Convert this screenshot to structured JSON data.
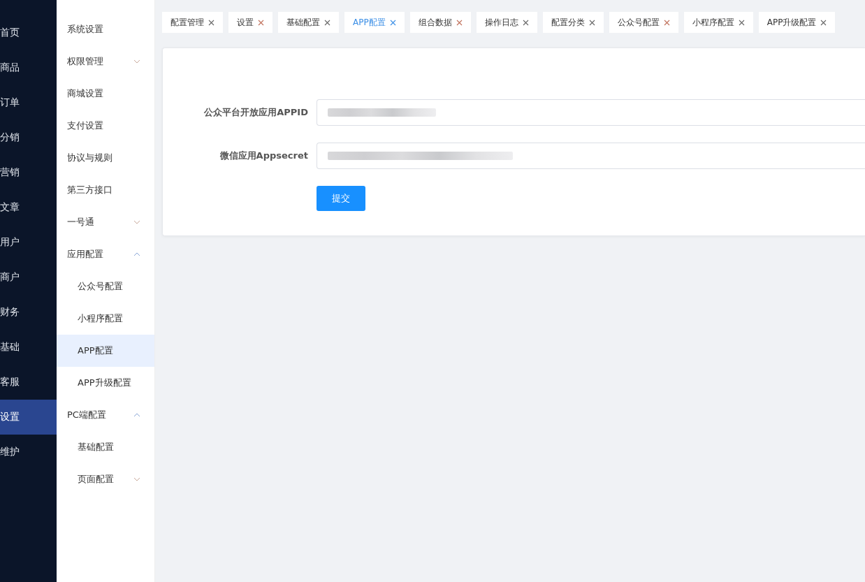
{
  "main_menu": [
    {
      "label": "首页",
      "selected": false
    },
    {
      "label": "商品",
      "selected": false
    },
    {
      "label": "订单",
      "selected": false
    },
    {
      "label": "分销",
      "selected": false
    },
    {
      "label": "营销",
      "selected": false
    },
    {
      "label": "文章",
      "selected": false
    },
    {
      "label": "用户",
      "selected": false
    },
    {
      "label": "商户",
      "selected": false
    },
    {
      "label": "财务",
      "selected": false
    },
    {
      "label": "基础",
      "selected": false
    },
    {
      "label": "客服",
      "selected": false
    },
    {
      "label": "设置",
      "selected": true
    },
    {
      "label": "维护",
      "selected": false
    }
  ],
  "sub_menu": [
    {
      "label": "系统设置",
      "selected": false
    },
    {
      "label": "权限管理",
      "selected": false,
      "expanded": false
    },
    {
      "label": "商城设置",
      "selected": false
    },
    {
      "label": "支付设置",
      "selected": false
    },
    {
      "label": "协议与规则",
      "selected": false
    },
    {
      "label": "第三方接口",
      "selected": false
    },
    {
      "label": "一号通",
      "selected": false,
      "expanded": false
    },
    {
      "label": "应用配置",
      "selected": false,
      "expanded": true,
      "children": [
        {
          "label": "公众号配置",
          "selected": false
        },
        {
          "label": "小程序配置",
          "selected": false
        },
        {
          "label": "APP配置",
          "selected": true
        },
        {
          "label": "APP升级配置",
          "selected": false
        }
      ]
    },
    {
      "label": "PC端配置",
      "selected": false,
      "expanded": true,
      "children": [
        {
          "label": "基础配置",
          "selected": false
        },
        {
          "label": "页面配置",
          "selected": false,
          "expanded": false
        }
      ]
    }
  ],
  "tabs": [
    {
      "label": "配置管理",
      "selected": false
    },
    {
      "label": "设置",
      "selected": false
    },
    {
      "label": "基础配置",
      "selected": false
    },
    {
      "label": "APP配置",
      "selected": true
    },
    {
      "label": "组合数据",
      "selected": false
    },
    {
      "label": "操作日志",
      "selected": false
    },
    {
      "label": "配置分类",
      "selected": false
    },
    {
      "label": "公众号配置",
      "selected": false
    },
    {
      "label": "小程序配置",
      "selected": false
    },
    {
      "label": "APP升级配置",
      "selected": false
    }
  ],
  "form": {
    "fields": [
      {
        "label": "公众平台开放应用APPID"
      },
      {
        "label": "微信应用Appsecret"
      }
    ],
    "submit": "提交"
  }
}
